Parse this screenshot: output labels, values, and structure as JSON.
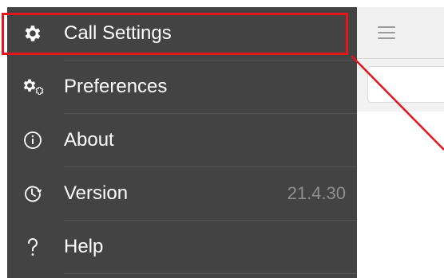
{
  "menu": {
    "items": [
      {
        "label": "Call Settings",
        "icon": "gear-icon",
        "value": ""
      },
      {
        "label": "Preferences",
        "icon": "gears-icon",
        "value": ""
      },
      {
        "label": "About",
        "icon": "info-icon",
        "value": ""
      },
      {
        "label": "Version",
        "icon": "clock-history-icon",
        "value": "21.4.30"
      },
      {
        "label": "Help",
        "icon": "question-icon",
        "value": ""
      }
    ]
  },
  "app": {
    "menu_icon": "hamburger-icon"
  },
  "annotation": {
    "color": "#e8141c",
    "target": "Call Settings"
  },
  "colors": {
    "drawer_bg": "#434343",
    "label_text": "#ffffff",
    "value_text": "#8f8f8f",
    "app_bg": "#f2f2f2"
  }
}
